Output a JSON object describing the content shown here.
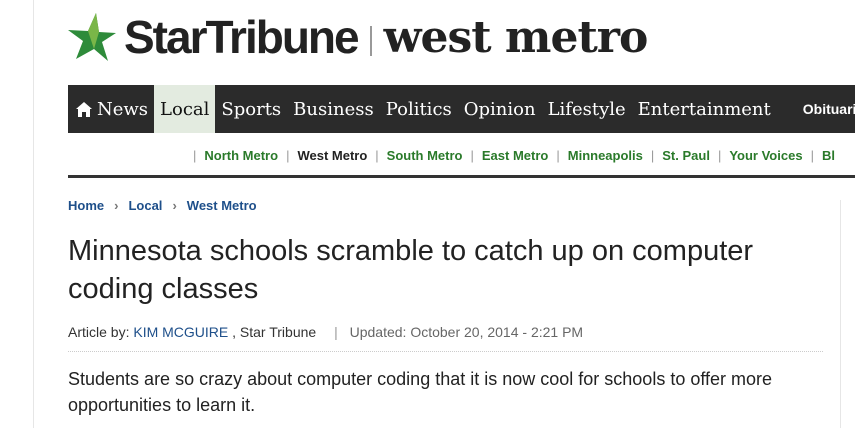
{
  "masthead": {
    "brand": "StarTribune",
    "section": "west metro",
    "star_colors": [
      "#2e8b3a",
      "#7ab648"
    ]
  },
  "mainnav": {
    "items": [
      {
        "label": "News",
        "icon": "home-icon"
      },
      {
        "label": "Local",
        "active": true
      },
      {
        "label": "Sports"
      },
      {
        "label": "Business"
      },
      {
        "label": "Politics"
      },
      {
        "label": "Opinion"
      },
      {
        "label": "Lifestyle"
      },
      {
        "label": "Entertainment"
      },
      {
        "label": "Obituaries"
      }
    ]
  },
  "subnav": {
    "items": [
      "North Metro",
      "West Metro",
      "South Metro",
      "East Metro",
      "Minneapolis",
      "St. Paul",
      "Your Voices",
      "Bl"
    ],
    "current": "West Metro"
  },
  "breadcrumb": [
    "Home",
    "Local",
    "West Metro"
  ],
  "article": {
    "headline": "Minnesota schools scramble to catch up on computer coding classes",
    "byline_prefix": "Article by:",
    "author": "KIM MCGUIRE",
    "source": ", Star Tribune",
    "updated": "Updated: October 20, 2014 - 2:21 PM",
    "dek": "Students are so crazy about computer coding that it is now cool for schools to offer more opportunities to learn it."
  },
  "colors": {
    "nav_bg": "#2b2b2b",
    "nav_active_bg": "#e3ebe0",
    "link_blue": "#1e4f8a",
    "subnav_green": "#2a7a2a"
  }
}
